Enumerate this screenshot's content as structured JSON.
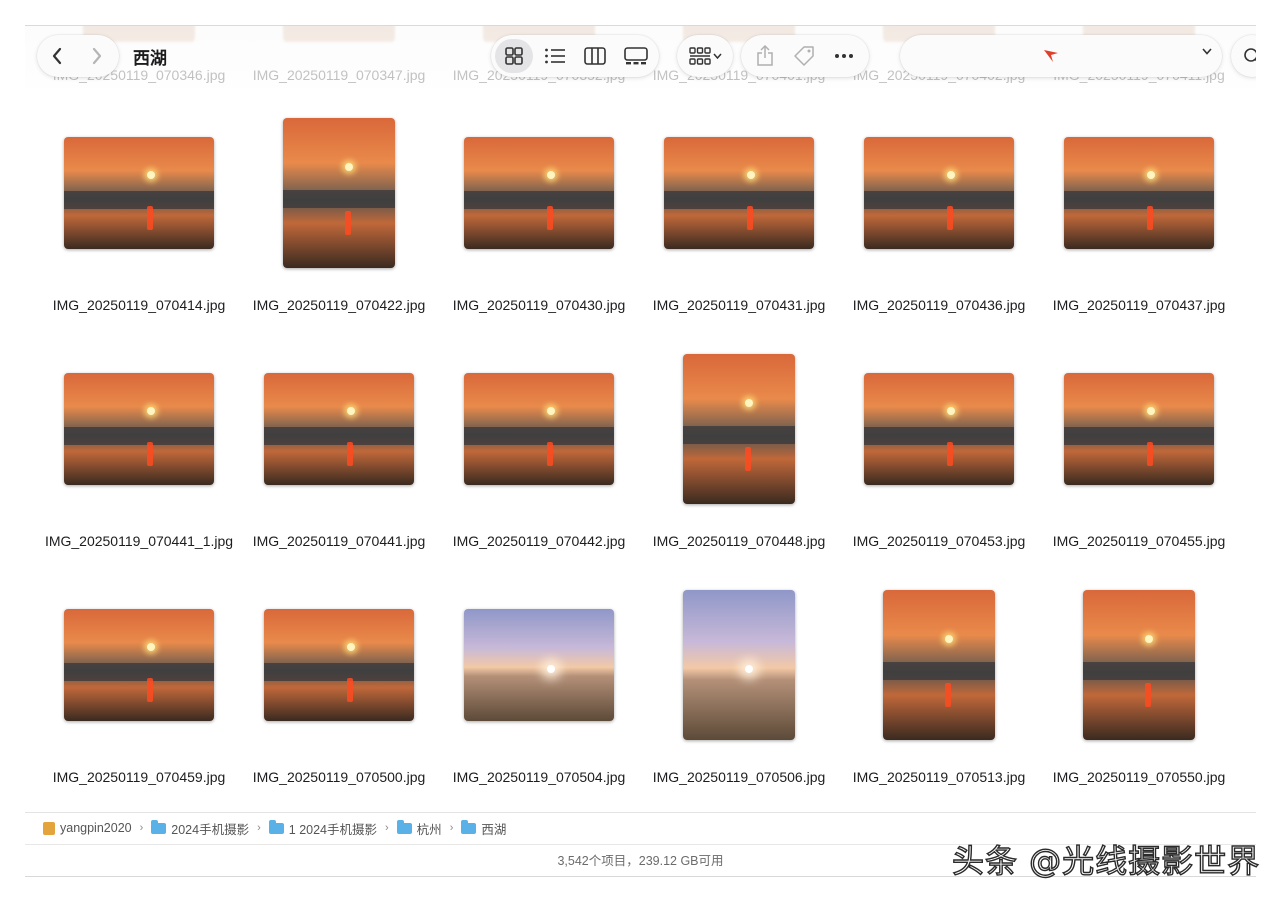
{
  "window": {
    "title": "西湖"
  },
  "previous_row_labels": [
    "IMG_20250119_070346.jpg",
    "IMG_20250119_070347.jpg",
    "IMG_20250119_070352.jpg",
    "IMG_20250119_070401.jpg",
    "IMG_20250119_070402.jpg",
    "IMG_20250119_070411.jpg"
  ],
  "toolbar": {
    "back_icon": "chevron-left-icon",
    "forward_icon": "chevron-right-icon",
    "view_icons": [
      "grid-view-icon",
      "list-view-icon",
      "column-view-icon",
      "gallery-view-icon"
    ],
    "active_view": "grid-view-icon",
    "group_icon": "group-by-icon",
    "action_icons": [
      "share-icon",
      "tag-icon",
      "more-icon"
    ],
    "accent": "#e0402a"
  },
  "files": [
    {
      "name": "IMG_20250119_070414.jpg",
      "orientation": "landscape",
      "tone": "sunset"
    },
    {
      "name": "IMG_20250119_070422.jpg",
      "orientation": "portrait",
      "tone": "sunset"
    },
    {
      "name": "IMG_20250119_070430.jpg",
      "orientation": "landscape",
      "tone": "sunset"
    },
    {
      "name": "IMG_20250119_070431.jpg",
      "orientation": "landscape",
      "tone": "sunset"
    },
    {
      "name": "IMG_20250119_070436.jpg",
      "orientation": "landscape",
      "tone": "sunset"
    },
    {
      "name": "IMG_20250119_070437.jpg",
      "orientation": "landscape",
      "tone": "sunset"
    },
    {
      "name": "IMG_20250119_070441_1.jpg",
      "orientation": "landscape",
      "tone": "sunset"
    },
    {
      "name": "IMG_20250119_070441.jpg",
      "orientation": "landscape",
      "tone": "sunset"
    },
    {
      "name": "IMG_20250119_070442.jpg",
      "orientation": "landscape",
      "tone": "sunset"
    },
    {
      "name": "IMG_20250119_070448.jpg",
      "orientation": "portrait",
      "tone": "sunset"
    },
    {
      "name": "IMG_20250119_070453.jpg",
      "orientation": "landscape",
      "tone": "sunset"
    },
    {
      "name": "IMG_20250119_070455.jpg",
      "orientation": "landscape",
      "tone": "sunset"
    },
    {
      "name": "IMG_20250119_070459.jpg",
      "orientation": "landscape",
      "tone": "sunset"
    },
    {
      "name": "IMG_20250119_070500.jpg",
      "orientation": "landscape",
      "tone": "sunset"
    },
    {
      "name": "IMG_20250119_070504.jpg",
      "orientation": "landscape",
      "tone": "dawn"
    },
    {
      "name": "IMG_20250119_070506.jpg",
      "orientation": "portrait",
      "tone": "dawn"
    },
    {
      "name": "IMG_20250119_070513.jpg",
      "orientation": "portrait",
      "tone": "sunset"
    },
    {
      "name": "IMG_20250119_070550.jpg",
      "orientation": "portrait",
      "tone": "sunset"
    }
  ],
  "path": [
    "yangpin2020",
    "2024手机摄影",
    "1 2024手机摄影",
    "杭州",
    "西湖"
  ],
  "status": "3,542个项目，239.12 GB可用",
  "watermark": "头条 @光线摄影世界"
}
